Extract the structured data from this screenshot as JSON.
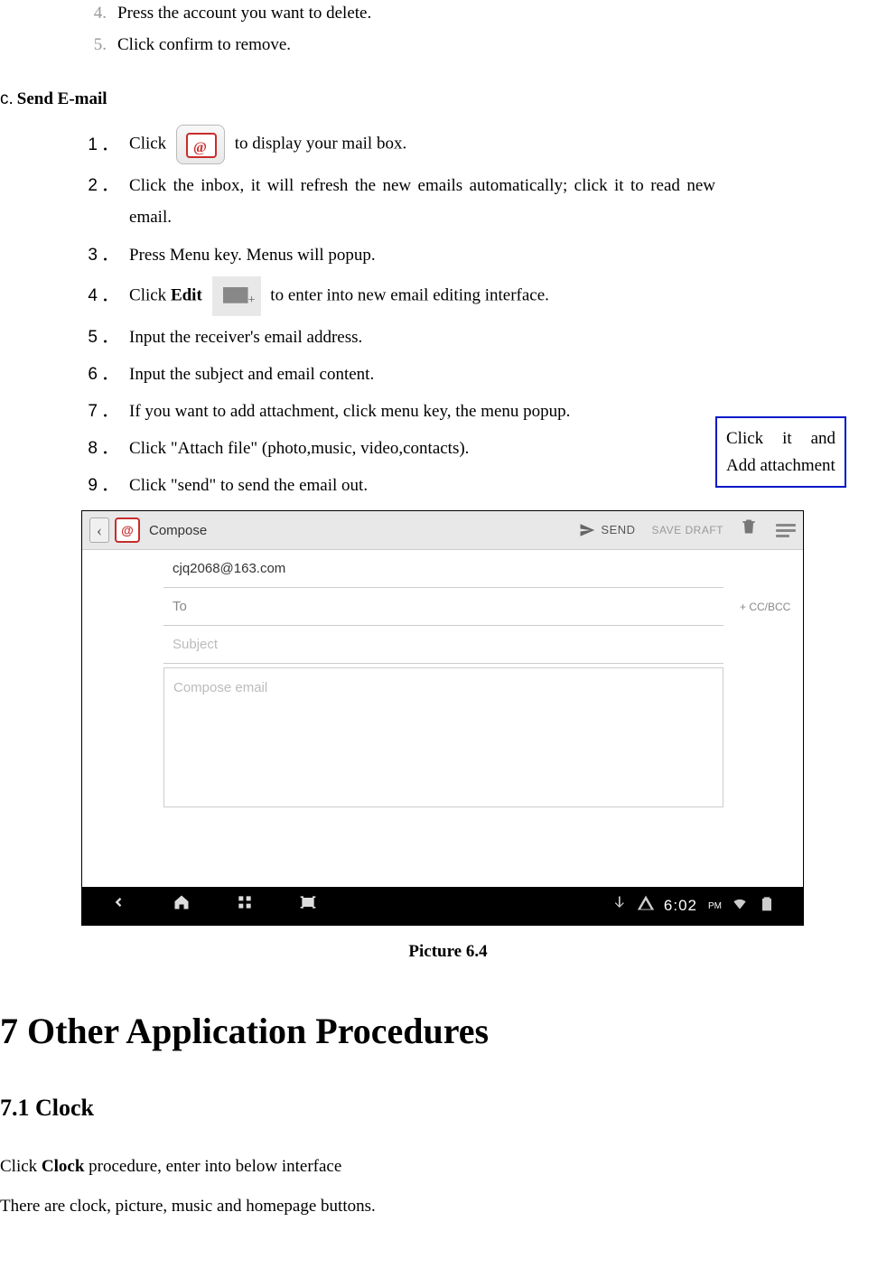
{
  "prev_list": [
    {
      "num": "4.",
      "text": "Press the account you want to delete."
    },
    {
      "num": "5.",
      "text": "Click confirm to remove."
    }
  ],
  "section_c": {
    "letter": "c.",
    "title": "Send E-mail"
  },
  "email_steps": {
    "s1a": "Click",
    "s1b": "to display your mail box.",
    "s2": "Click the inbox, it will refresh the new emails automatically; click it to read new email.",
    "s3": "Press Menu key. Menus will popup.",
    "s4a": "Click ",
    "s4_bold": "Edit",
    "s4b": " to enter into new email editing interface.",
    "s5": "Input the receiver's email address.",
    "s6": "Input the subject and email content.",
    "s7": "If you want to add attachment, click menu key, the menu popup.",
    "s8": "Click \"Attach file\" (photo,music, video,contacts).",
    "s9": "Click \"send\" to send the email out."
  },
  "callout": "Click it and Add attachment",
  "compose_ui": {
    "app_badge": "@",
    "title": "Compose",
    "send": "SEND",
    "save_draft": "SAVE DRAFT",
    "from": "cjq2068@163.com",
    "to_placeholder": "To",
    "ccbcc": "+ CC/BCC",
    "subject_placeholder": "Subject",
    "body_placeholder": "Compose email",
    "time": "6:02",
    "time_suffix": "PM"
  },
  "caption": "Picture 6.4",
  "h1": "7 Other Application Procedures",
  "h2": "7.1 Clock",
  "p1a": "Click ",
  "p1_bold": "Clock",
  "p1b": " procedure, enter into below interface",
  "p2": "There are clock, picture, music and homepage buttons."
}
